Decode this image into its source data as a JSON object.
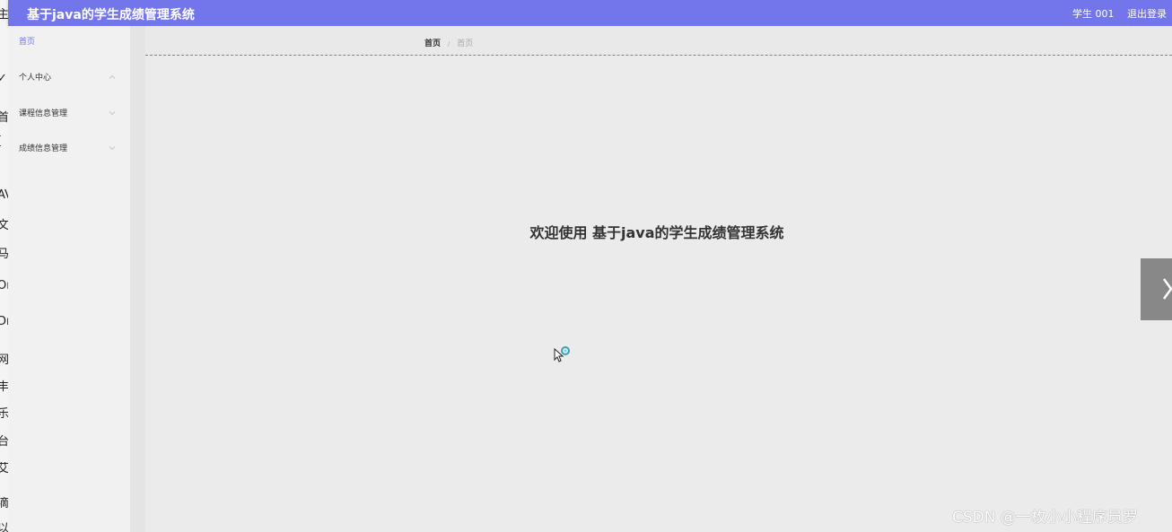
{
  "header": {
    "app_title": "基于java的学生成绩管理系统",
    "user_label": "学生 001",
    "logout_label": "退出登录"
  },
  "sidebar": {
    "items": [
      {
        "label": "首页",
        "active": true
      },
      {
        "label": "个人中心",
        "expanded": true
      },
      {
        "label": "课程信息管理",
        "expanded": false
      },
      {
        "label": "成绩信息管理",
        "expanded": false
      }
    ]
  },
  "breadcrumb": {
    "home": "首页",
    "separator": "/",
    "current": "首页"
  },
  "main": {
    "welcome_text": "欢迎使用 基于java的学生成绩管理系统"
  },
  "background_window": {
    "fragments": [
      "主",
      "✓",
      "首",
      "[",
      "AV",
      "文",
      "马",
      "Or",
      "Dr",
      "网",
      "丰",
      "乐",
      "台",
      "艾",
      "滴",
      "以"
    ]
  },
  "watermark": "CSDN @一枚小小程序员罗",
  "colors": {
    "accent": "#7376ea",
    "sidebar_bg": "#f1f1f1",
    "content_bg": "#ebebeb"
  },
  "icons": {
    "sidebar_chevrons": [
      "chevron-up-icon",
      "chevron-down-icon",
      "chevron-down-icon"
    ],
    "next_arrow": "chevron-right-icon",
    "cursor": "busy-cursor-icon"
  }
}
